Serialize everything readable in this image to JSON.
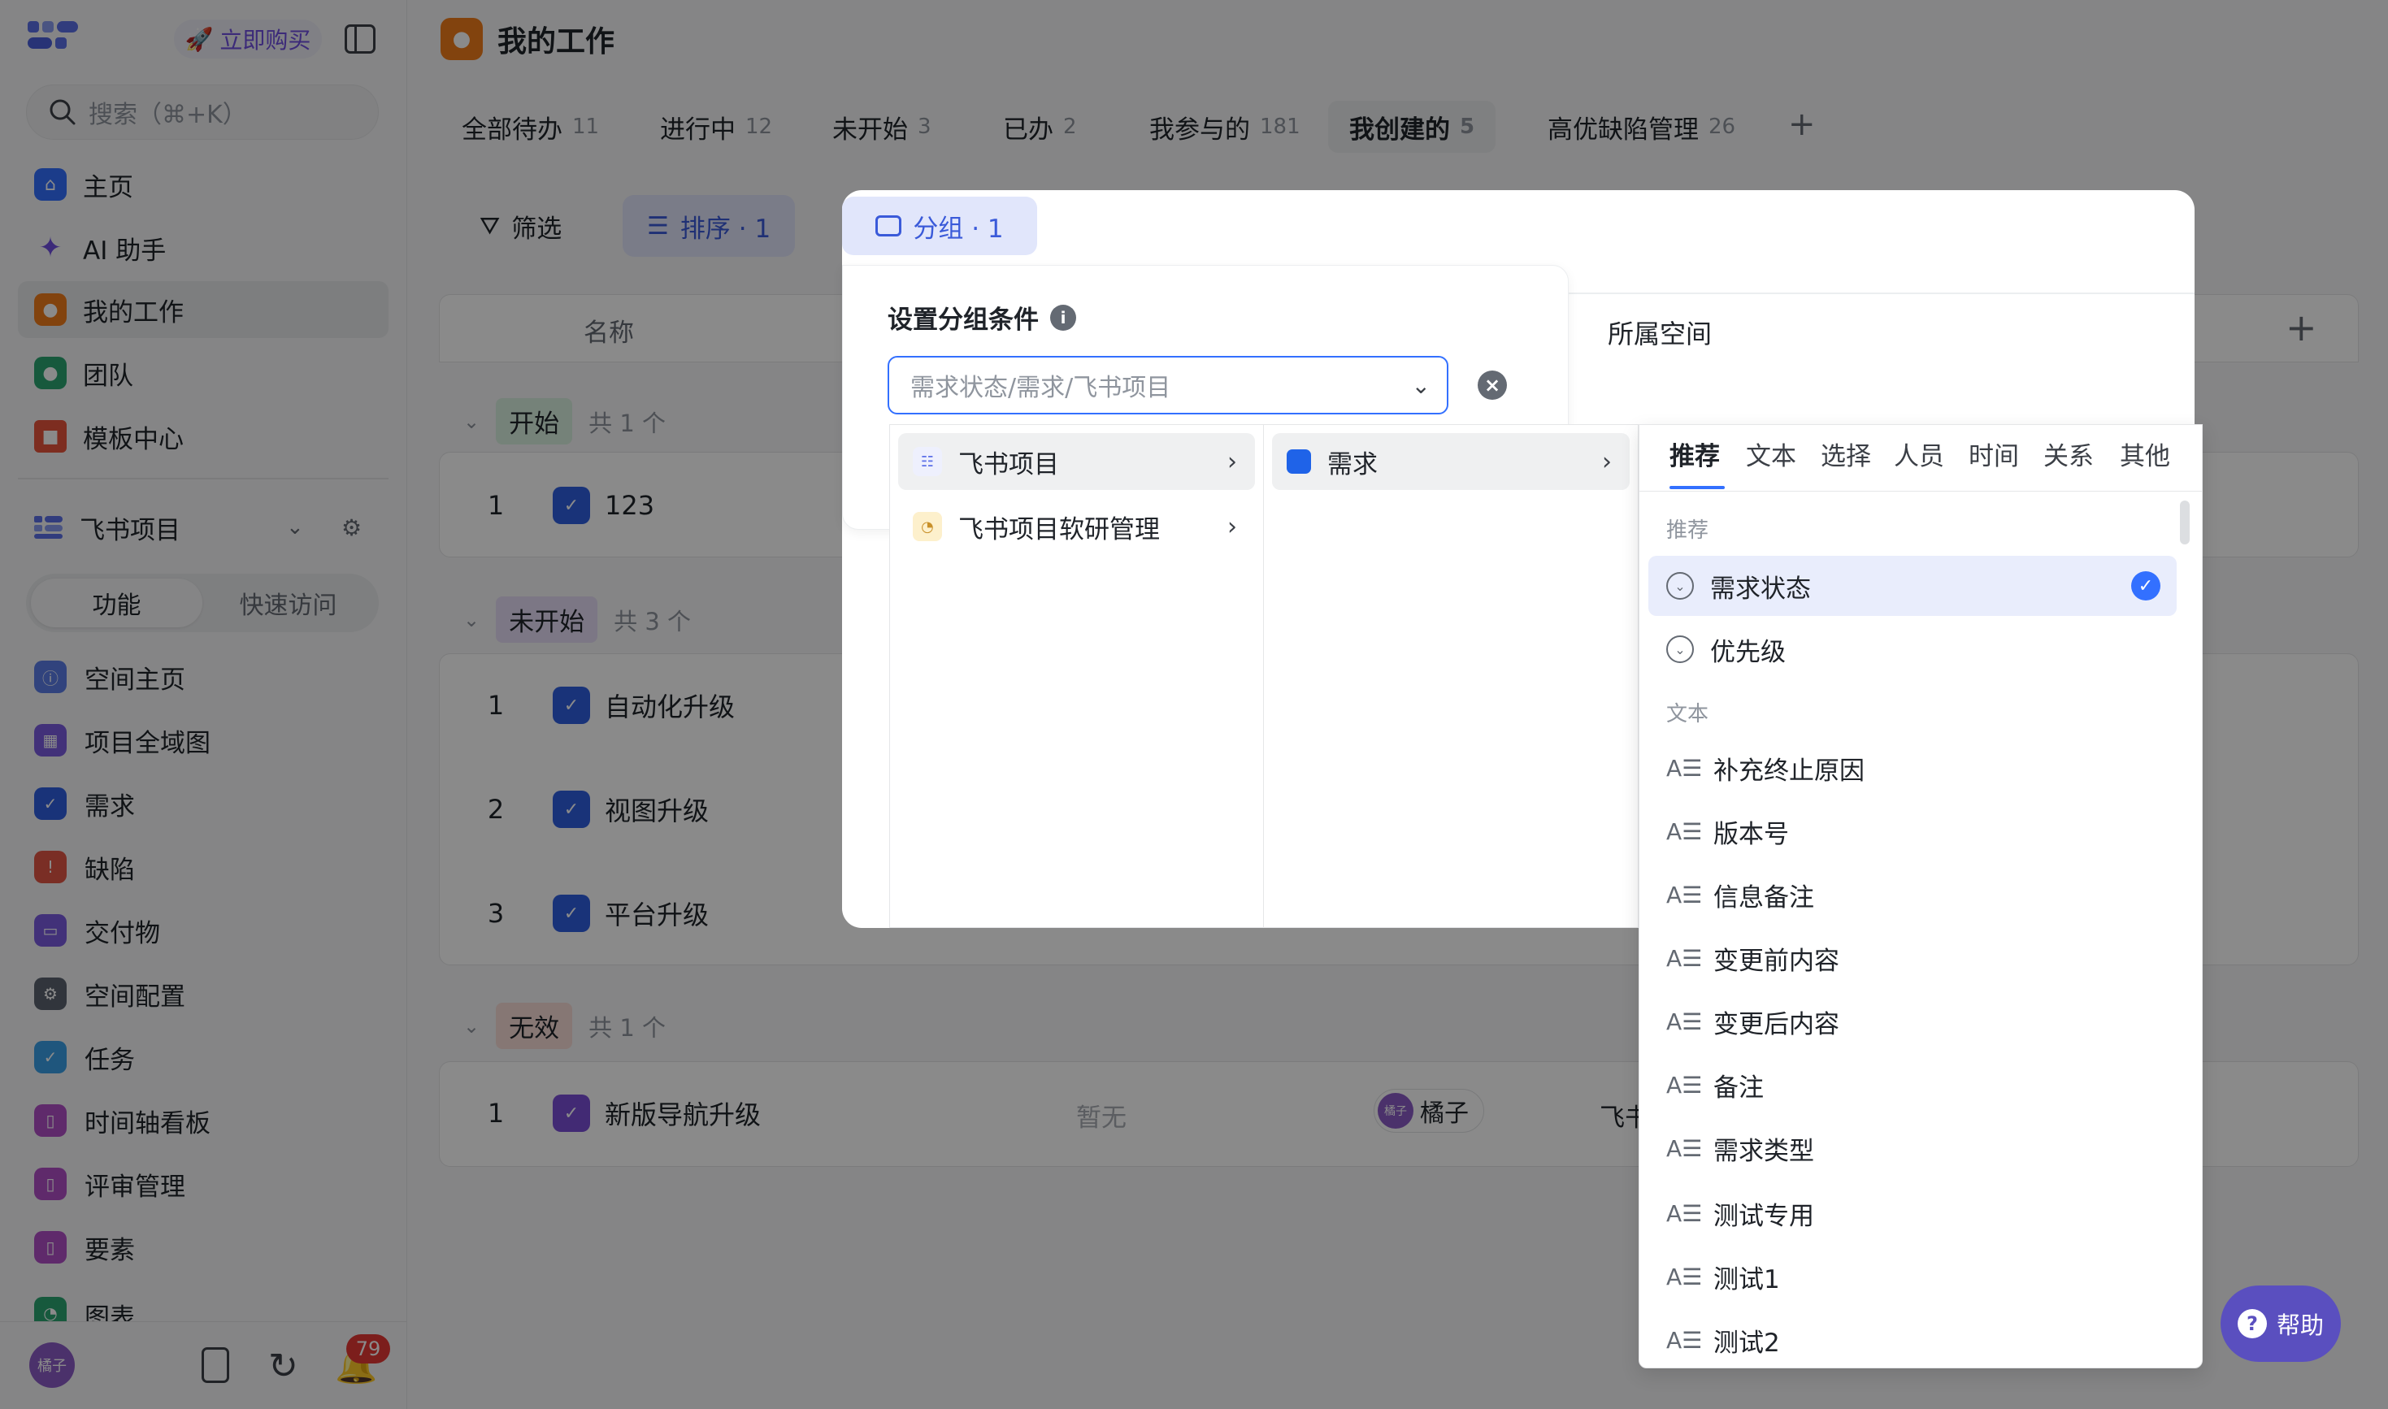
{
  "sidebar": {
    "buy_label": "立即购买",
    "search_placeholder": "搜索（⌘+K）",
    "nav": [
      {
        "label": "主页"
      },
      {
        "label": "AI 助手"
      },
      {
        "label": "我的工作"
      },
      {
        "label": "团队"
      },
      {
        "label": "模板中心"
      }
    ],
    "project_name": "飞书项目",
    "segments": [
      "功能",
      "快速访问"
    ],
    "items": [
      {
        "label": "空间主页"
      },
      {
        "label": "项目全域图"
      },
      {
        "label": "需求"
      },
      {
        "label": "缺陷"
      },
      {
        "label": "交付物"
      },
      {
        "label": "空间配置"
      },
      {
        "label": "任务"
      },
      {
        "label": "时间轴看板"
      },
      {
        "label": "评审管理"
      },
      {
        "label": "要素"
      },
      {
        "label": "图表"
      }
    ],
    "user_avatar": "橘子",
    "notification_count": "79"
  },
  "main": {
    "title": "我的工作",
    "tabs": [
      {
        "label": "全部待办",
        "count": "11"
      },
      {
        "label": "进行中",
        "count": "12"
      },
      {
        "label": "未开始",
        "count": "3"
      },
      {
        "label": "已办",
        "count": "2"
      },
      {
        "label": "我参与的",
        "count": "181"
      },
      {
        "label": "我创建的",
        "count": "5"
      },
      {
        "label": "高优缺陷管理",
        "count": "26"
      }
    ],
    "tab_add": "+",
    "toolbar": {
      "filter": "筛选",
      "sort": "排序 · 1",
      "group": "分组 · 1"
    },
    "columns": {
      "name": "名称",
      "space": "所属空间",
      "add": "+"
    },
    "groups": [
      {
        "tag": "开始",
        "count": "共 1 个",
        "rows": [
          {
            "num": "1",
            "name": "123"
          }
        ]
      },
      {
        "tag": "未开始",
        "count": "共 3 个",
        "rows": [
          {
            "num": "1",
            "name": "自动化升级"
          },
          {
            "num": "2",
            "name": "视图升级"
          },
          {
            "num": "3",
            "name": "平台升级"
          }
        ]
      },
      {
        "tag": "无效",
        "count": "共 1 个",
        "rows": [
          {
            "num": "1",
            "name": "新版导航升级",
            "extra": "暂无",
            "owner": "橘子",
            "space": "飞书"
          }
        ]
      }
    ]
  },
  "group_panel": {
    "title": "设置分组条件",
    "select_value": "需求状态/需求/飞书项目",
    "level1": [
      {
        "label": "飞书项目"
      },
      {
        "label": "飞书项目软研管理"
      }
    ],
    "level2": [
      {
        "label": "需求"
      }
    ],
    "field_tabs": [
      "推荐",
      "文本",
      "选择",
      "人员",
      "时间",
      "关系",
      "其他"
    ],
    "sections": {
      "recommended": "推荐",
      "text": "文本"
    },
    "recommended": [
      "需求状态",
      "优先级"
    ],
    "text_fields": [
      "补充终止原因",
      "版本号",
      "信息备注",
      "变更前内容",
      "变更后内容",
      "备注",
      "需求类型",
      "测试专用",
      "测试1",
      "测试2"
    ],
    "text_icon": "A☰"
  },
  "help": {
    "label": "帮助"
  },
  "colors": {
    "accent": "#3370ff",
    "brand_purple": "#6f4fe0",
    "help_bg": "#5a4fbf"
  }
}
